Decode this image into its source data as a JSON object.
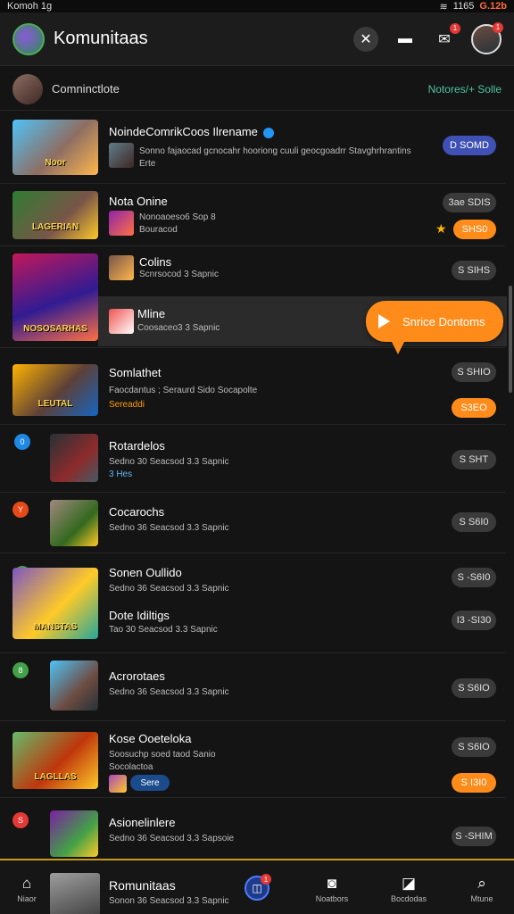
{
  "status": {
    "time": "Komoh 1g",
    "battery": "G.12b",
    "signal": "1165"
  },
  "appbar": {
    "title": "Komunitaas"
  },
  "section": {
    "label": "Comninctlote",
    "link": "Notores/+ Solle"
  },
  "rows": [
    {
      "title": "NoindeComrikCoos Ilrename",
      "sub": "Sonno fajaocad gcnocahr hooriong cuuli geocgoadrr Stavghrhrantins",
      "sub2": "Erte",
      "pill": "D SOMD",
      "thumb_caption": "Noor"
    },
    {
      "title": "Nota Onine",
      "sub": "Nonoaoeso6 Sop 8",
      "sub2": "Bouracod",
      "pill": "3ae SDIS",
      "pill2": "SHS0",
      "thumb_caption": "LAGERIAN"
    },
    {
      "title": "Colins",
      "sub": "Scnrsocod 3 Sapnic",
      "pill": "S SIHS",
      "thumb_caption": "NOSOSARHAS"
    },
    {
      "title": "Mline",
      "sub": "Coosaceo3 3 Sapnic"
    },
    {
      "title": "Somlathet",
      "sub": "Faocdantus ; Seraurd Sido Socapolte",
      "sub2": "Sereaddi",
      "pill": "S SHIO",
      "pill2": "S3EO",
      "thumb_caption": "LEUTAL"
    },
    {
      "title": "Rotardelos",
      "sub": "Sedno 30 Seacsod 3.3 Sapnic",
      "sub2": "3 Hes",
      "pill": "S SHT",
      "dot": "0"
    },
    {
      "title": "Cocarochs",
      "sub": "Sedno 36 Seacsod 3.3 Sapnic",
      "pill": "S S6I0",
      "dot": "Y"
    },
    {
      "title": "Sonen Oullido",
      "sub": "Sedno 36 Seacsod 3.3 Sapnic",
      "pill": "S -S6I0",
      "dot": "6",
      "thumb_caption": "MANSTAS"
    },
    {
      "title": "Dote Idiltigs",
      "sub": "Tao 30 Seacsod 3.3 Sapnic",
      "pill": "I3 -SI30"
    },
    {
      "title": "Acrorotaes",
      "sub": "Sedno 36 Seacsod 3.3 Sapnic",
      "pill": "S S6IO",
      "dot": "8"
    },
    {
      "title": "Kose Ooeteloka",
      "sub": "Soosuchp soed taod Sanio",
      "sub2": "Socolactoa",
      "chip": "Sere",
      "pill": "S S6IO",
      "pill2": "S I3I0",
      "thumb_caption": "LAGLLAS"
    },
    {
      "title": "Asionelinlere",
      "sub": "Sedno 36 Seacsod 3.3 Sapsoie",
      "pill": "S -SHIM",
      "dot": "S"
    }
  ],
  "tooltip": {
    "label": "Snrice Dontoms"
  },
  "nav": {
    "home": "Niaor",
    "title": "Romunitaas",
    "sub": "Sonon 36 Seacsod 3.3 Sapnic",
    "chat": "Noatbors",
    "bookmarks": "Bocdodas",
    "search": "Mtune",
    "badge": "1"
  },
  "colors": {
    "accent": "#ff8c1a",
    "link": "#4fc3a1",
    "nav_accent": "#c79a1c"
  }
}
